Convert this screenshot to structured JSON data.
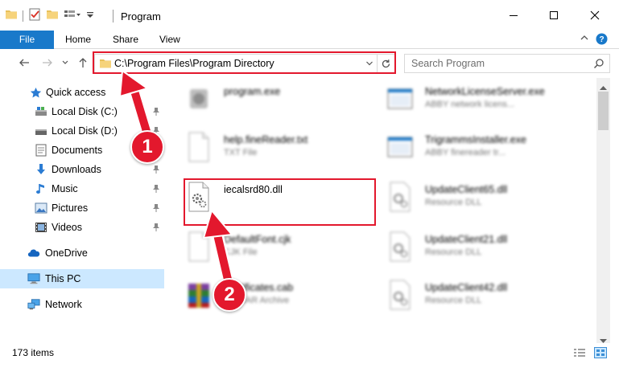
{
  "window": {
    "title": "Program"
  },
  "ribbon": {
    "tabs": [
      {
        "label": "File",
        "active": true
      },
      {
        "label": "Home"
      },
      {
        "label": "Share"
      },
      {
        "label": "View"
      }
    ]
  },
  "address": {
    "path": "C:\\Program Files\\Program Directory",
    "search_placeholder": "Search Program"
  },
  "sidebar": {
    "items": [
      {
        "label": "Quick access",
        "icon": "star-icon",
        "pinned": false
      },
      {
        "label": "Local Disk (C:)",
        "icon": "drive-icon",
        "pinned": true
      },
      {
        "label": "Local Disk (D:)",
        "icon": "drive-icon",
        "pinned": true
      },
      {
        "label": "Documents",
        "icon": "document-icon",
        "pinned": true
      },
      {
        "label": "Downloads",
        "icon": "download-icon",
        "pinned": true
      },
      {
        "label": "Music",
        "icon": "music-icon",
        "pinned": true
      },
      {
        "label": "Pictures",
        "icon": "pictures-icon",
        "pinned": true
      },
      {
        "label": "Videos",
        "icon": "video-icon",
        "pinned": true
      },
      {
        "label": "OneDrive",
        "icon": "cloud-icon",
        "pinned": false
      },
      {
        "label": "This PC",
        "icon": "computer-icon",
        "pinned": false,
        "selected": true
      },
      {
        "label": "Network",
        "icon": "network-icon",
        "pinned": false
      }
    ]
  },
  "files": [
    {
      "name": "program.exe",
      "desc": "",
      "icon": "exe-icon",
      "blurred": true
    },
    {
      "name": "NetworkLicenseServer.exe",
      "desc": "ABBY network licens...",
      "icon": "window-icon",
      "blurred": true
    },
    {
      "name": "help.fineReader.txt",
      "desc": "TXT File",
      "icon": "text-file-icon",
      "blurred": true
    },
    {
      "name": "TrigrammsInstaller.exe",
      "desc": "ABBY finereader tr...",
      "icon": "window-icon",
      "blurred": true
    },
    {
      "name": "iecalsrd80.dll",
      "desc": "",
      "icon": "dll-gear-icon",
      "blurred": false
    },
    {
      "name": "UpdateClient65.dll",
      "desc": "Resource DLL",
      "icon": "dll-gear-icon",
      "blurred": true
    },
    {
      "name": "DefaultFont.cjk",
      "desc": "CJK File",
      "icon": "blank-file-icon",
      "blurred": true
    },
    {
      "name": "UpdateClient21.dll",
      "desc": "Resource DLL",
      "icon": "dll-gear-icon",
      "blurred": true
    },
    {
      "name": "Certificates.cab",
      "desc": "WinRAR Archive",
      "icon": "archive-icon",
      "blurred": true
    },
    {
      "name": "UpdateClient42.dll",
      "desc": "Resource DLL",
      "icon": "dll-gear-icon",
      "blurred": true
    }
  ],
  "status": {
    "count": "173 items"
  },
  "callouts": [
    "1",
    "2"
  ],
  "colors": {
    "accent": "#1979ca",
    "highlight": "#e3182d",
    "selected": "#cce8ff"
  }
}
